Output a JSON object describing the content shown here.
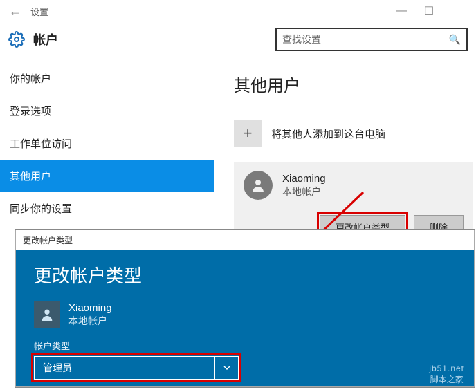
{
  "titlebar": {
    "title": "设置"
  },
  "header": {
    "title": "帐户",
    "search_placeholder": "查找设置"
  },
  "sidebar": {
    "items": [
      {
        "label": "你的帐户"
      },
      {
        "label": "登录选项"
      },
      {
        "label": "工作单位访问"
      },
      {
        "label": "其他用户"
      },
      {
        "label": "同步你的设置"
      }
    ]
  },
  "content": {
    "section_title": "其他用户",
    "add_label": "将其他人添加到这台电脑",
    "user": {
      "name": "Xiaoming",
      "type": "本地帐户"
    },
    "actions": {
      "change": "更改帐户类型",
      "delete": "删除"
    }
  },
  "modal": {
    "titlebar": "更改帐户类型",
    "heading": "更改帐户类型",
    "user": {
      "name": "Xiaoming",
      "type": "本地帐户"
    },
    "field_label": "帐户类型",
    "selected": "管理员"
  },
  "watermark": {
    "url": "jb51.net",
    "text": "脚本之家"
  }
}
